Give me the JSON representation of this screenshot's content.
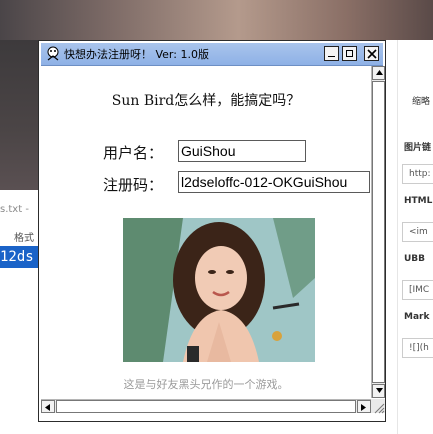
{
  "window": {
    "title": "快想办法注册呀！  Ver: 1.0版"
  },
  "dialog": {
    "question": "Sun Bird怎么样，能搞定吗？",
    "username_label": "用户名：",
    "username_value": "GuiShou",
    "regcode_label": "注册码：",
    "regcode_value": "l2dseloffc-012-OKGuiShou",
    "caption": "这是与好友黑头兄作的一个游戏。"
  },
  "background_app": {
    "filename_fragment": "s.txt -",
    "format_label": "格式",
    "selected_text": "12ds",
    "right_panel": {
      "item1": "缩略",
      "label_image": "图片链",
      "box_http": "http:",
      "label_html": "HTML",
      "box_img": "<im",
      "label_ubb": "UBB",
      "box_ubb": "[IMC",
      "label_markdown": "Mark",
      "box_md": "![](h"
    }
  },
  "colors": {
    "titlebar": "#a9c4ec",
    "selection": "#1a63c8",
    "caption": "#9a9a9a"
  }
}
